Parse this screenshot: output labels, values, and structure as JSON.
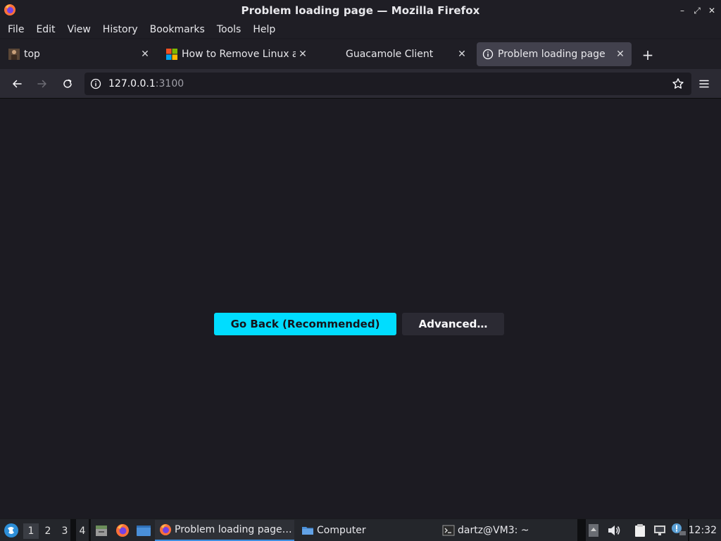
{
  "window": {
    "title": "Problem loading page — Mozilla Firefox",
    "controls": {
      "minimize": "–",
      "restore": "⤢",
      "close": "✕"
    }
  },
  "menubar": {
    "items": [
      "File",
      "Edit",
      "View",
      "History",
      "Bookmarks",
      "Tools",
      "Help"
    ]
  },
  "tabs": [
    {
      "label": "top",
      "icon": "user-avatar-icon",
      "active": false
    },
    {
      "label": "How to Remove Linux an",
      "icon": "windows-logo-icon",
      "active": false
    },
    {
      "label": "Guacamole Client",
      "icon": "none",
      "active": false
    },
    {
      "label": "Problem loading page",
      "icon": "info-icon",
      "active": true
    }
  ],
  "tab_close_glyph": "✕",
  "new_tab_glyph": "+",
  "navbar": {
    "url_host": "127.0.0.1",
    "url_port": ":3100"
  },
  "page": {
    "primary_button": "Go Back (Recommended)",
    "secondary_button": "Advanced…"
  },
  "taskbar": {
    "workspaces": [
      "1",
      "2",
      "3",
      "4"
    ],
    "active_workspace": "1",
    "tasks": [
      {
        "label": "Problem loading page…",
        "icon": "firefox-icon",
        "active": true
      },
      {
        "label": "Computer",
        "icon": "folder-icon",
        "active": false
      },
      {
        "label": "dartz@VM3: ~",
        "icon": "terminal-icon",
        "active": false
      }
    ],
    "clock": "12:32"
  },
  "colors": {
    "accent": "#00ddff",
    "page_bg": "#1c1b22",
    "chrome_bg": "#1f1e25",
    "toolbar_bg": "#2b2a33",
    "active_tab_bg": "#42414d"
  }
}
